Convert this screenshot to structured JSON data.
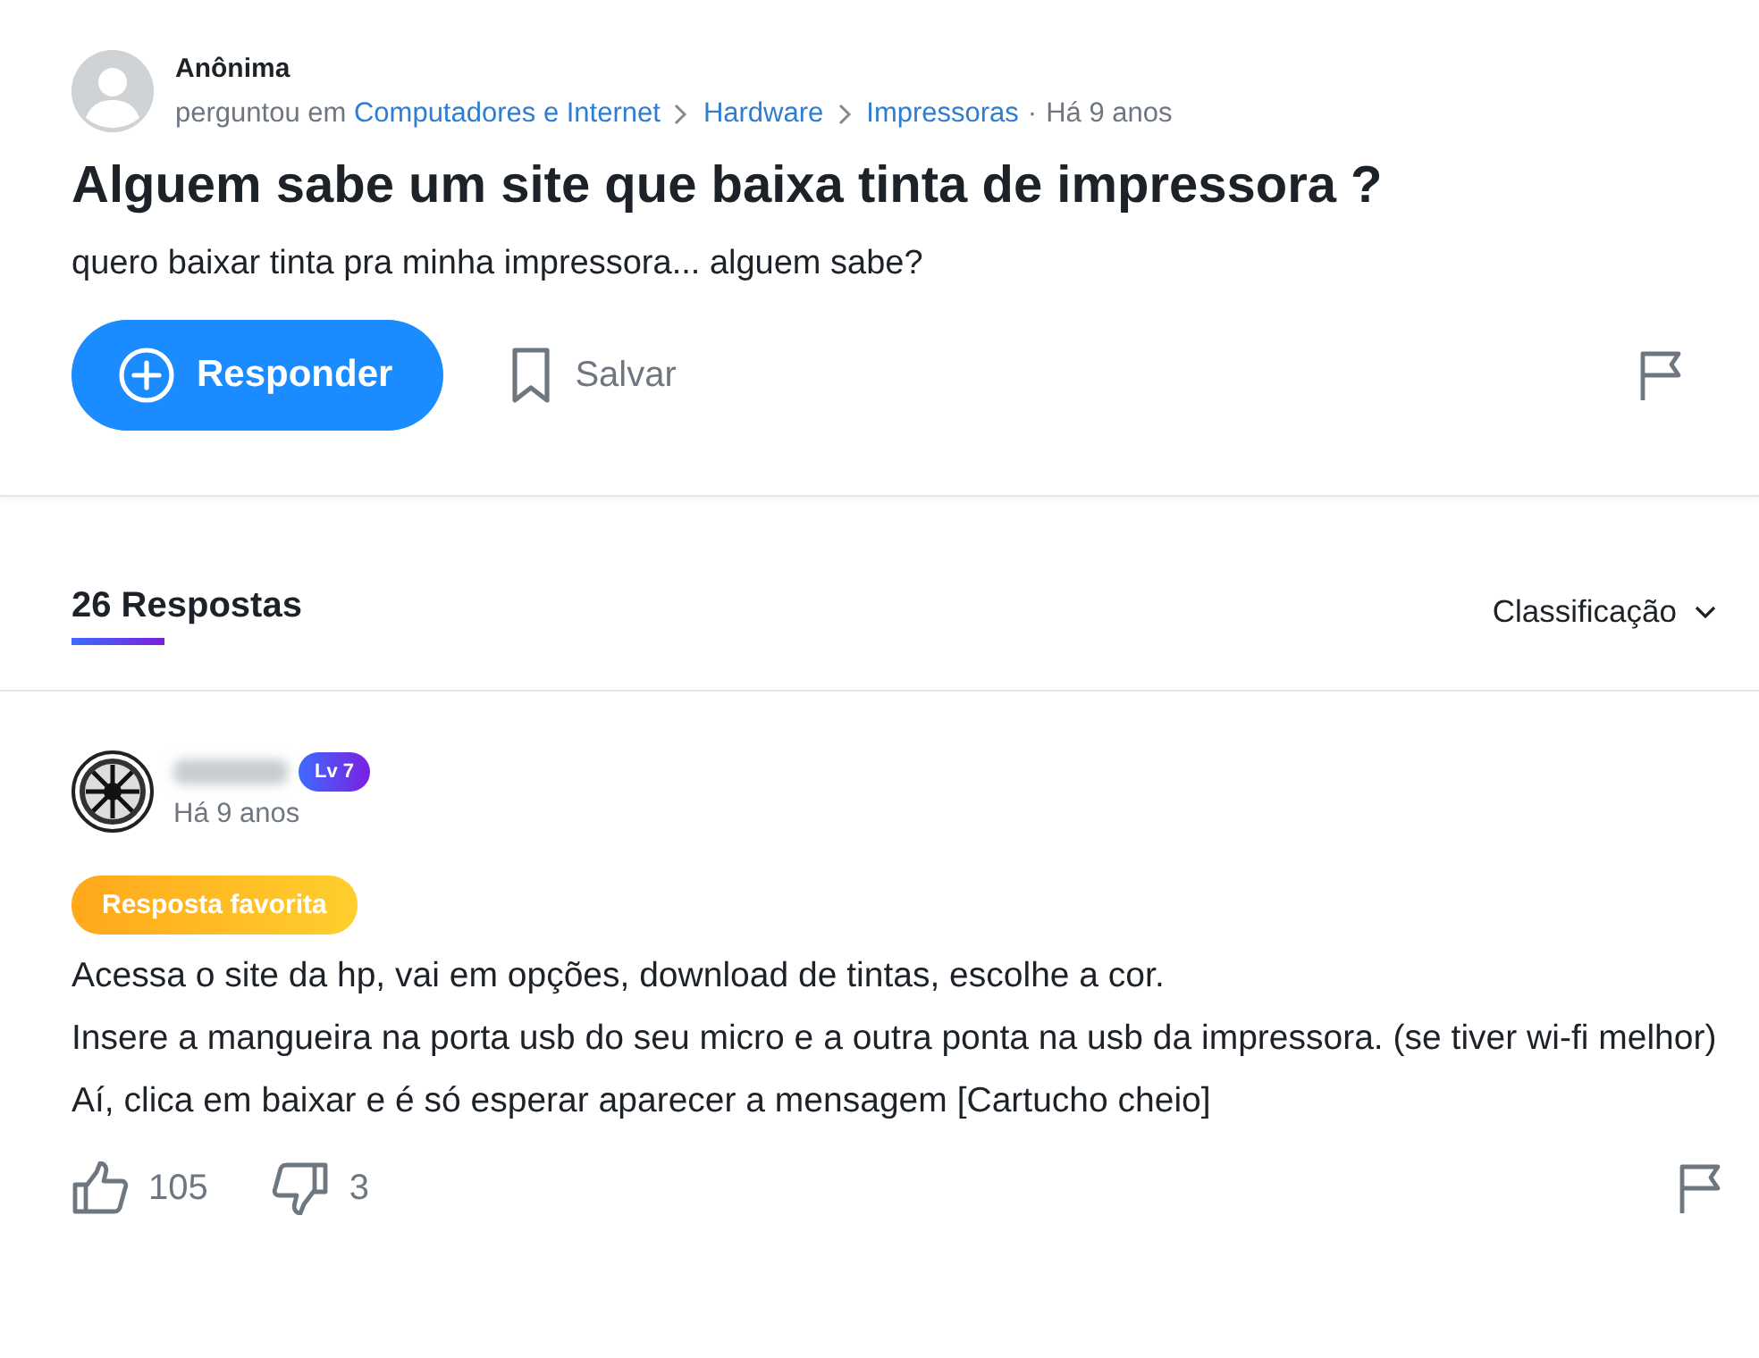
{
  "question": {
    "author": "Anônima",
    "asked_in": "perguntou em",
    "breadcrumbs": [
      "Computadores e Internet",
      "Hardware",
      "Impressoras"
    ],
    "separator": "·",
    "time": "Há 9 anos",
    "title": "Alguem sabe um site que baixa tinta de impressora ?",
    "body": "quero baixar tinta pra minha impressora... alguem sabe?",
    "answer_button": "Responder",
    "save_button": "Salvar"
  },
  "answers_header": {
    "count_label": "26 Respostas",
    "sort": "Classificação"
  },
  "answers": [
    {
      "level": "Lv 7",
      "time": "Há 9 anos",
      "badge": "Resposta favorita",
      "paragraphs": [
        "Acessa o site da hp, vai em opções, download de tintas, escolhe a cor.",
        "Insere a mangueira na porta usb do seu micro e a outra ponta na usb da impressora. (se tiver wi-fi melhor)",
        "Aí, clica em baixar e é só esperar aparecer a mensagem [Cartucho cheio]"
      ],
      "likes": "105",
      "dislikes": "3"
    }
  ]
}
